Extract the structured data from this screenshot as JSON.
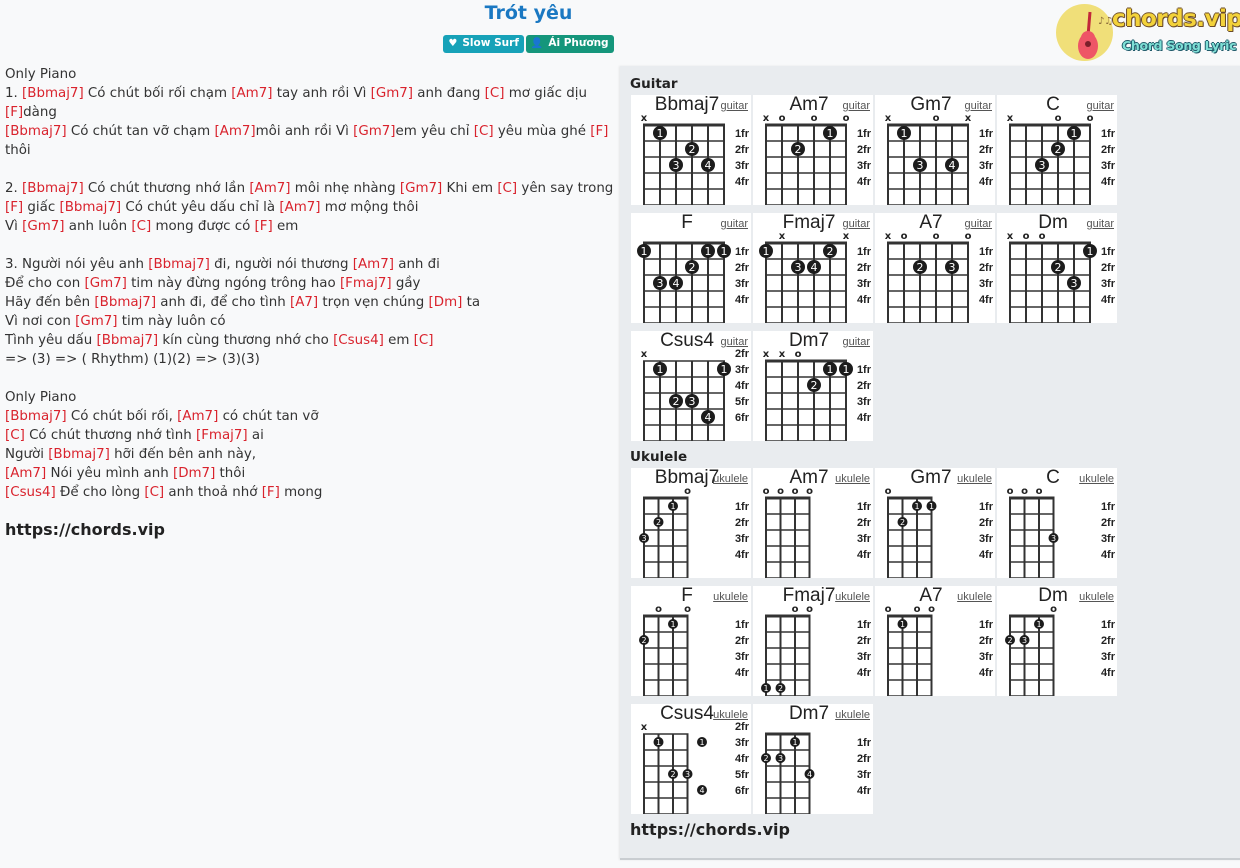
{
  "song": {
    "title": "Trót yêu",
    "rhythm": {
      "icon": "heartbeat-icon",
      "label": "Slow Surf"
    },
    "artist": {
      "icon": "user-icon",
      "label": "Ái Phương"
    }
  },
  "logo": {
    "main": "chords.vip",
    "sub": "Chord Song Lyric"
  },
  "lyrics": [
    [
      {
        "t": "Only Piano"
      }
    ],
    [
      {
        "t": "1. "
      },
      {
        "c": "[Bbmaj7]"
      },
      {
        "t": " Có chút bối rối chạm "
      },
      {
        "c": "[Am7]"
      },
      {
        "t": " tay anh rồi Vì "
      },
      {
        "c": "[Gm7]"
      },
      {
        "t": " anh đang "
      },
      {
        "c": "[C]"
      },
      {
        "t": " mơ giấc dịu"
      }
    ],
    [
      {
        "c": "[F]"
      },
      {
        "t": "dàng"
      }
    ],
    [
      {
        "c": "[Bbmaj7]"
      },
      {
        "t": " Có chút tan vỡ chạm "
      },
      {
        "c": "[Am7]"
      },
      {
        "t": "môi anh rồi Vì "
      },
      {
        "c": "[Gm7]"
      },
      {
        "t": "em yêu chỉ "
      },
      {
        "c": "[C]"
      },
      {
        "t": " yêu mùa ghé "
      },
      {
        "c": "[F]"
      }
    ],
    [
      {
        "t": "thôi"
      }
    ],
    [],
    [
      {
        "t": "2. "
      },
      {
        "c": "[Bbmaj7]"
      },
      {
        "t": " Có chút thương nhớ lần "
      },
      {
        "c": "[Am7]"
      },
      {
        "t": " môi nhẹ nhàng "
      },
      {
        "c": "[Gm7]"
      },
      {
        "t": " Khi em "
      },
      {
        "c": "[C]"
      },
      {
        "t": " yên say trong"
      }
    ],
    [
      {
        "c": "[F]"
      },
      {
        "t": " giấc "
      },
      {
        "c": "[Bbmaj7]"
      },
      {
        "t": " Có chút yêu dấu chỉ là "
      },
      {
        "c": "[Am7]"
      },
      {
        "t": " mơ mộng thôi"
      }
    ],
    [
      {
        "t": "Vì "
      },
      {
        "c": "[Gm7]"
      },
      {
        "t": " anh luôn "
      },
      {
        "c": "[C]"
      },
      {
        "t": " mong được có "
      },
      {
        "c": "[F]"
      },
      {
        "t": " em"
      }
    ],
    [],
    [
      {
        "t": "3. Người nói yêu anh "
      },
      {
        "c": "[Bbmaj7]"
      },
      {
        "t": " đi, người nói thương "
      },
      {
        "c": "[Am7]"
      },
      {
        "t": " anh đi"
      }
    ],
    [
      {
        "t": "Để cho con "
      },
      {
        "c": "[Gm7]"
      },
      {
        "t": " tim này đừng ngóng trông hao "
      },
      {
        "c": "[Fmaj7]"
      },
      {
        "t": " gầy"
      }
    ],
    [
      {
        "t": "Hãy đến bên "
      },
      {
        "c": "[Bbmaj7]"
      },
      {
        "t": " anh đi, để cho tình "
      },
      {
        "c": "[A7]"
      },
      {
        "t": " trọn vẹn chúng "
      },
      {
        "c": "[Dm]"
      },
      {
        "t": " ta"
      }
    ],
    [
      {
        "t": "Vì nơi con "
      },
      {
        "c": "[Gm7]"
      },
      {
        "t": " tim này luôn có"
      }
    ],
    [
      {
        "t": "Tình yêu dấu "
      },
      {
        "c": "[Bbmaj7]"
      },
      {
        "t": " kín cùng thương nhớ cho "
      },
      {
        "c": "[Csus4]"
      },
      {
        "t": " em "
      },
      {
        "c": "[C]"
      }
    ],
    [
      {
        "t": "=> (3) => ( Rhythm) (1)(2) => (3)(3)"
      }
    ],
    [],
    [
      {
        "t": "Only Piano"
      }
    ],
    [
      {
        "c": "[Bbmaj7]"
      },
      {
        "t": " Có chút bối rối, "
      },
      {
        "c": "[Am7]"
      },
      {
        "t": " có chút tan vỡ"
      }
    ],
    [
      {
        "c": "[C]"
      },
      {
        "t": " Có chút thương nhớ tình "
      },
      {
        "c": "[Fmaj7]"
      },
      {
        "t": " ai"
      }
    ],
    [
      {
        "t": "Người "
      },
      {
        "c": "[Bbmaj7]"
      },
      {
        "t": " hỡi đến bên anh này,"
      }
    ],
    [
      {
        "c": "[Am7]"
      },
      {
        "t": " Nói yêu mình anh "
      },
      {
        "c": "[Dm7]"
      },
      {
        "t": " thôi"
      }
    ],
    [
      {
        "c": "[Csus4]"
      },
      {
        "t": " Để cho lòng "
      },
      {
        "c": "[C]"
      },
      {
        "t": " anh thoả nhớ "
      },
      {
        "c": "[F]"
      },
      {
        "t": " mong"
      }
    ]
  ],
  "footer_link": "https://chords.vip",
  "panel": {
    "guitar_title": "Guitar",
    "ukulele_title": "Ukulele",
    "footer_link": "https://chords.vip"
  },
  "guitar_chords": [
    {
      "name": "Bbmaj7",
      "label": "guitar",
      "base": 1,
      "marks": [
        "x",
        "",
        "",
        "",
        "",
        ""
      ],
      "nut": true,
      "dots": [
        [
          2,
          1,
          "1"
        ],
        [
          4,
          2,
          "2"
        ],
        [
          3,
          3,
          "3"
        ],
        [
          5,
          3,
          "4"
        ]
      ],
      "barre": [
        [
          2,
          1
        ],
        [
          6,
          1
        ]
      ]
    },
    {
      "name": "Am7",
      "label": "guitar",
      "base": 1,
      "marks": [
        "x",
        "o",
        "",
        "o",
        "",
        "o"
      ],
      "nut": true,
      "dots": [
        [
          5,
          1,
          "1"
        ],
        [
          3,
          2,
          "2"
        ]
      ]
    },
    {
      "name": "Gm7",
      "label": "guitar",
      "base": 1,
      "marks": [
        "x",
        "",
        "",
        "o",
        "",
        "x"
      ],
      "nut": true,
      "dots": [
        [
          2,
          1,
          "1"
        ],
        [
          3,
          3,
          "3"
        ],
        [
          5,
          3,
          "4"
        ]
      ]
    },
    {
      "name": "C",
      "label": "guitar",
      "base": 1,
      "marks": [
        "x",
        "",
        "",
        "o",
        "",
        "o"
      ],
      "nut": true,
      "dots": [
        [
          5,
          1,
          "1"
        ],
        [
          4,
          2,
          "2"
        ],
        [
          3,
          3,
          "3"
        ]
      ]
    },
    {
      "name": "F",
      "label": "guitar",
      "base": 1,
      "marks": [
        "",
        "",
        "",
        "",
        "",
        ""
      ],
      "nut": true,
      "dots": [
        [
          1,
          1,
          "1"
        ],
        [
          5,
          1,
          "1"
        ],
        [
          6,
          1,
          "1"
        ],
        [
          4,
          2,
          "2"
        ],
        [
          2,
          3,
          "3"
        ],
        [
          3,
          3,
          "4"
        ]
      ]
    },
    {
      "name": "Fmaj7",
      "label": "guitar",
      "base": 1,
      "marks": [
        "",
        "x",
        "",
        "",
        "",
        "x"
      ],
      "nut": true,
      "dots": [
        [
          1,
          1,
          "1"
        ],
        [
          5,
          1,
          "2"
        ],
        [
          3,
          2,
          "3"
        ],
        [
          4,
          2,
          "4"
        ]
      ]
    },
    {
      "name": "A7",
      "label": "guitar",
      "base": 1,
      "marks": [
        "x",
        "o",
        "",
        "o",
        "",
        "o"
      ],
      "nut": true,
      "dots": [
        [
          3,
          2,
          "2"
        ],
        [
          5,
          2,
          "3"
        ]
      ]
    },
    {
      "name": "Dm",
      "label": "guitar",
      "base": 1,
      "marks": [
        "x",
        "o",
        "o",
        "",
        "",
        ""
      ],
      "nut": true,
      "dots": [
        [
          6,
          1,
          "1"
        ],
        [
          4,
          2,
          "2"
        ],
        [
          5,
          3,
          "3"
        ]
      ]
    },
    {
      "name": "Csus4",
      "label": "guitar",
      "base": 3,
      "marks": [
        "x",
        "",
        "",
        "",
        "",
        ""
      ],
      "nut": false,
      "fretlabels": [
        "2fr",
        "3fr",
        "4fr",
        "5fr",
        "6fr"
      ],
      "dots": [
        [
          2,
          1,
          "1"
        ],
        [
          6,
          1,
          "1"
        ],
        [
          3,
          3,
          "2"
        ],
        [
          4,
          3,
          "3"
        ],
        [
          5,
          4,
          "4"
        ]
      ]
    },
    {
      "name": "Dm7",
      "label": "guitar",
      "base": 1,
      "marks": [
        "x",
        "x",
        "o",
        "",
        "",
        ""
      ],
      "nut": true,
      "dots": [
        [
          5,
          1,
          "1"
        ],
        [
          6,
          1,
          "1"
        ],
        [
          4,
          2,
          "2"
        ]
      ]
    }
  ],
  "ukulele_chords": [
    {
      "name": "Bbmaj7",
      "label": "ukulele",
      "marks": [
        "",
        "",
        "",
        "o"
      ],
      "dots": [
        [
          3,
          1,
          "1"
        ],
        [
          2,
          2,
          "2"
        ],
        [
          1,
          3,
          "3"
        ]
      ]
    },
    {
      "name": "Am7",
      "label": "ukulele",
      "marks": [
        "o",
        "o",
        "o",
        "o"
      ],
      "dots": []
    },
    {
      "name": "Gm7",
      "label": "ukulele",
      "marks": [
        "o",
        "",
        "",
        ""
      ],
      "dots": [
        [
          3,
          1,
          "1"
        ],
        [
          4,
          1,
          "1"
        ],
        [
          2,
          2,
          "2"
        ]
      ]
    },
    {
      "name": "C",
      "label": "ukulele",
      "marks": [
        "o",
        "o",
        "o",
        ""
      ],
      "dots": [
        [
          4,
          3,
          "3"
        ]
      ]
    },
    {
      "name": "F",
      "label": "ukulele",
      "marks": [
        "",
        "o",
        "",
        "o"
      ],
      "dots": [
        [
          3,
          1,
          "1"
        ],
        [
          1,
          2,
          "2"
        ]
      ]
    },
    {
      "name": "Fmaj7",
      "label": "ukulele",
      "marks": [
        "",
        "",
        "o",
        "o"
      ],
      "dots": [
        [
          1,
          5,
          "1"
        ],
        [
          2,
          5,
          "2"
        ]
      ]
    },
    {
      "name": "A7",
      "label": "ukulele",
      "marks": [
        "o",
        "",
        "o",
        "o"
      ],
      "dots": [
        [
          2,
          1,
          "1"
        ]
      ]
    },
    {
      "name": "Dm",
      "label": "ukulele",
      "marks": [
        "",
        "",
        "",
        "o"
      ],
      "dots": [
        [
          3,
          1,
          "1"
        ],
        [
          1,
          2,
          "2"
        ],
        [
          2,
          2,
          "3"
        ]
      ]
    },
    {
      "name": "Csus4",
      "label": "ukulele",
      "marks": [
        "x",
        "",
        "",
        ""
      ],
      "fretlabels": [
        "2fr",
        "3fr",
        "4fr",
        "5fr",
        "6fr"
      ],
      "nut": false,
      "dots": [
        [
          2,
          1,
          "1"
        ],
        [
          5,
          1,
          "1"
        ],
        [
          3,
          3,
          "2"
        ],
        [
          4,
          3,
          "3"
        ],
        [
          5,
          4,
          "4"
        ]
      ]
    },
    {
      "name": "Dm7",
      "label": "ukulele",
      "marks": [
        "",
        "",
        "",
        ""
      ],
      "dots": [
        [
          3,
          1,
          "1"
        ],
        [
          1,
          2,
          "2"
        ],
        [
          2,
          2,
          "3"
        ],
        [
          4,
          3,
          "4"
        ]
      ]
    }
  ],
  "fret_labels_default": [
    "1fr",
    "2fr",
    "3fr",
    "4fr"
  ]
}
